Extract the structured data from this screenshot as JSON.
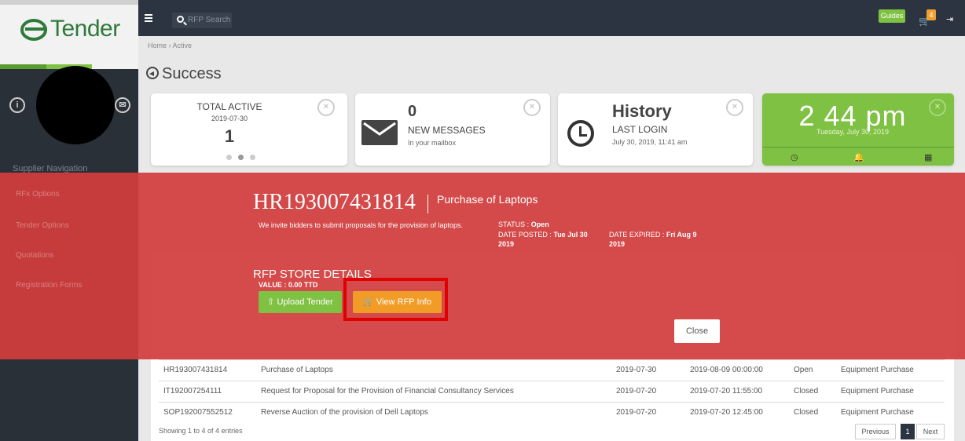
{
  "logo": {
    "text": "Tender",
    "prefix": "e"
  },
  "sidebar": {
    "nav_title": "Supplier Navigation",
    "items": [
      "RFx Options",
      "Tender Options",
      "Quotations",
      "Registration Forms"
    ],
    "stripe_colors": [
      "#5a9c2e",
      "#7fc142",
      "#f2f2f2"
    ]
  },
  "header": {
    "search_placeholder": "RFP Search",
    "guides_label": "Guides",
    "cart_count": "4"
  },
  "breadcrumb": {
    "home": "Home",
    "sep": "›",
    "current": "Active"
  },
  "page": {
    "title": "Success"
  },
  "cards": {
    "total": {
      "title": "TOTAL ACTIVE",
      "date": "2019-07-30",
      "value": "1"
    },
    "messages": {
      "value": "0",
      "label": "NEW MESSAGES",
      "sub": "In your mailbox"
    },
    "history": {
      "title": "History",
      "label": "LAST LOGIN",
      "sub": "July 30, 2019, 11:41 am"
    },
    "clock": {
      "time": "2 44 pm",
      "date": "Tuesday, July 30, 2019"
    }
  },
  "modal": {
    "code": "HR193007431814",
    "subject": "Purchase of Laptops",
    "description": "We invite bidders to submit proposals for the provision of laptops.",
    "status_label": "STATUS :",
    "status_value": "Open",
    "posted_label": "DATE POSTED :",
    "posted_value": "Tue Jul 30 2019",
    "expired_label": "DATE EXPIRED :",
    "expired_value": "Fri Aug 9 2019",
    "store_title": "RFP STORE DETAILS",
    "store_value": "VALUE : 0.00 TTD",
    "upload_label": "Upload Tender",
    "view_label": "View RFP Info",
    "close_label": "Close"
  },
  "table": {
    "rows": [
      {
        "rfp": "HR193007431814",
        "title": "Purchase of Laptops",
        "posted": "2019-07-30",
        "expires": "2019-08-09 00:00:00",
        "status": "Open",
        "type": "Equipment Purchase"
      },
      {
        "rfp": "IT192007254111",
        "title": "Request for Proposal for the Provision of Financial Consultancy Services",
        "posted": "2019-07-20",
        "expires": "2019-07-20 11:55:00",
        "status": "Closed",
        "type": "Equipment Purchase"
      },
      {
        "rfp": "SOP192007552512",
        "title": "Reverse Auction of the provision of Dell Laptops",
        "posted": "2019-07-20",
        "expires": "2019-07-20 12:45:00",
        "status": "Closed",
        "type": "Equipment Purchase"
      }
    ],
    "showing": "Showing 1 to 4 of 4 entries",
    "previous": "Previous",
    "page": "1",
    "next": "Next"
  },
  "colors": {
    "overlay": "#d23c3c",
    "green": "#7fc142",
    "orange": "#f29c28",
    "highlight": "#e00000",
    "sidebar": "#2a3038"
  }
}
